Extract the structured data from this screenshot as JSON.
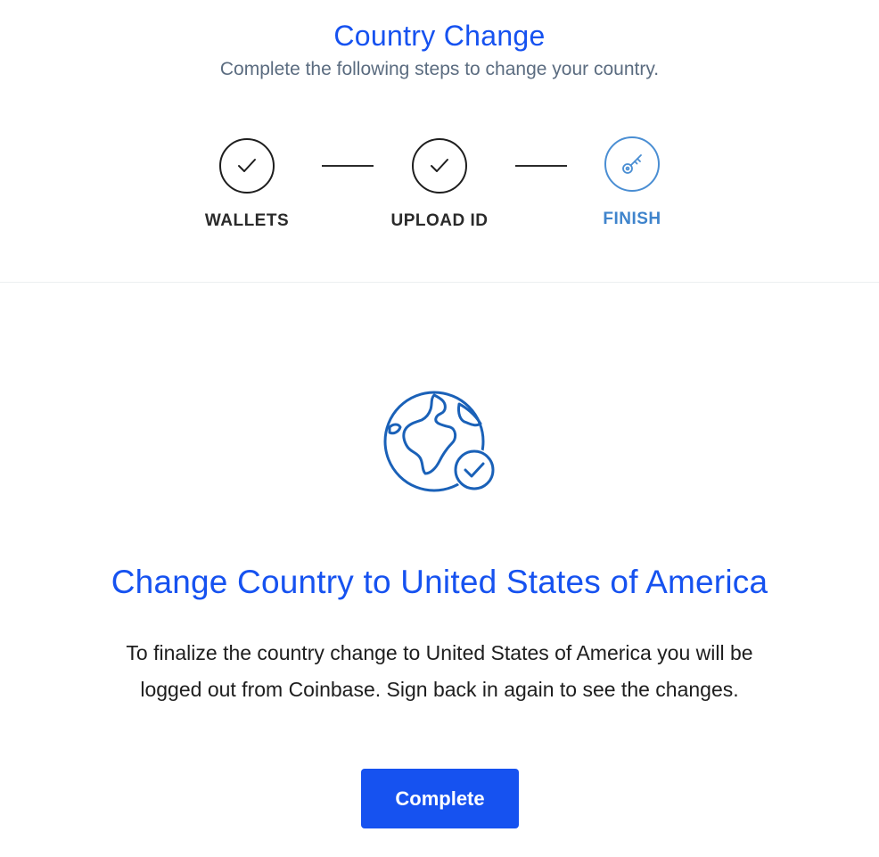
{
  "header": {
    "title": "Country Change",
    "subtitle": "Complete the following steps to change your country."
  },
  "steps": [
    {
      "label": "WALLETS",
      "icon": "checkmark-icon",
      "status": "complete"
    },
    {
      "label": "UPLOAD ID",
      "icon": "checkmark-icon",
      "status": "complete"
    },
    {
      "label": "FINISH",
      "icon": "key-icon",
      "status": "active"
    }
  ],
  "main": {
    "illustration_icon": "globe-check-icon",
    "heading": "Change Country to United States of America",
    "body_line1": "To finalize the country change to United States of America you will be",
    "body_line2": "logged out from Coinbase. Sign back in again to see the changes.",
    "button_label": "Complete"
  },
  "colors": {
    "brand_blue": "#1652f0",
    "step_active": "#3f84cc",
    "text_dark": "#1e1e1e",
    "subtitle_gray": "#5b6c80"
  }
}
